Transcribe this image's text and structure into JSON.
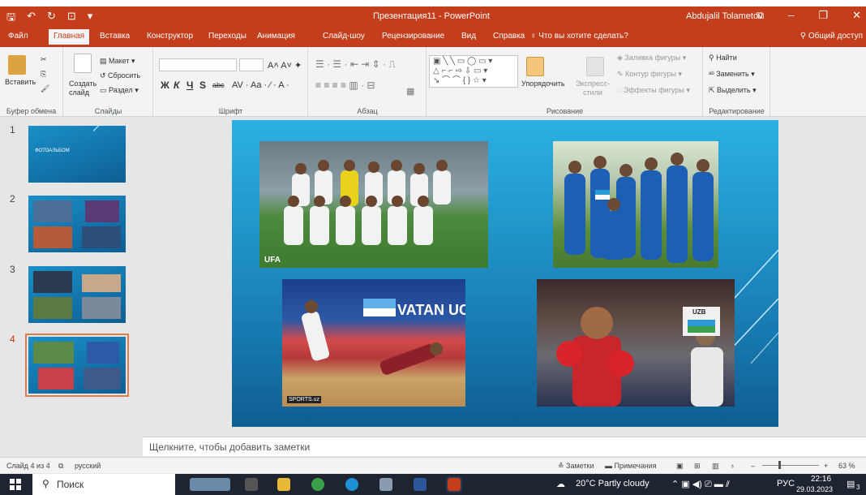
{
  "title_bar": {
    "document_title": "Презентация11 - PowerPoint",
    "user_name": "Abdujalil Tolametov"
  },
  "tabs": [
    {
      "label": "Файл"
    },
    {
      "label": "Главная"
    },
    {
      "label": "Вставка"
    },
    {
      "label": "Конструктор"
    },
    {
      "label": "Переходы"
    },
    {
      "label": "Анимация"
    },
    {
      "label": "Слайд-шоу"
    },
    {
      "label": "Рецензирование"
    },
    {
      "label": "Вид"
    },
    {
      "label": "Справка"
    }
  ],
  "tell_me": "Что вы хотите сделать?",
  "share": "Общий доступ",
  "ribbon": {
    "clipboard": {
      "paste": "Вставить",
      "group": "Буфер обмена"
    },
    "slides": {
      "new_slide": "Создать слайд",
      "layout": "Макет",
      "reset": "Сбросить",
      "section": "Раздел",
      "group": "Слайды"
    },
    "font": {
      "bold": "Ж",
      "italic": "К",
      "underline": "Ч",
      "shadow": "S",
      "strike": "abc",
      "group": "Шрифт"
    },
    "paragraph": {
      "group": "Абзац"
    },
    "drawing": {
      "arrange": "Упорядочить",
      "quick_styles": "Экспресс-стили",
      "fill": "Заливка фигуры",
      "outline": "Контур фигуры",
      "effects": "Эффекты фигуры",
      "group": "Рисование"
    },
    "editing": {
      "find": "Найти",
      "replace": "Заменить",
      "select": "Выделить",
      "group": "Редактирование"
    }
  },
  "thumbnails": [
    {
      "number": "1",
      "text": "ФОТОАЛЬБОМ"
    },
    {
      "number": "2"
    },
    {
      "number": "3"
    },
    {
      "number": "4"
    }
  ],
  "slide_photos": {
    "banner_text": "VATAN UCH",
    "box_label": "UZB",
    "corner_label": "UFA",
    "watermark": "SPORTS.uz"
  },
  "notes_placeholder": "Щелкните, чтобы добавить заметки",
  "status_bar": {
    "slide_counter": "Слайд 4 из 4",
    "language": "русский",
    "notes": "Заметки",
    "comments": "Примечания",
    "zoom": "63 %"
  },
  "taskbar": {
    "search_placeholder": "Поиск",
    "weather": "20°C  Partly cloudy",
    "lang": "РУС",
    "time": "22:16",
    "date": "29.03.2023",
    "notification_count": "3"
  }
}
